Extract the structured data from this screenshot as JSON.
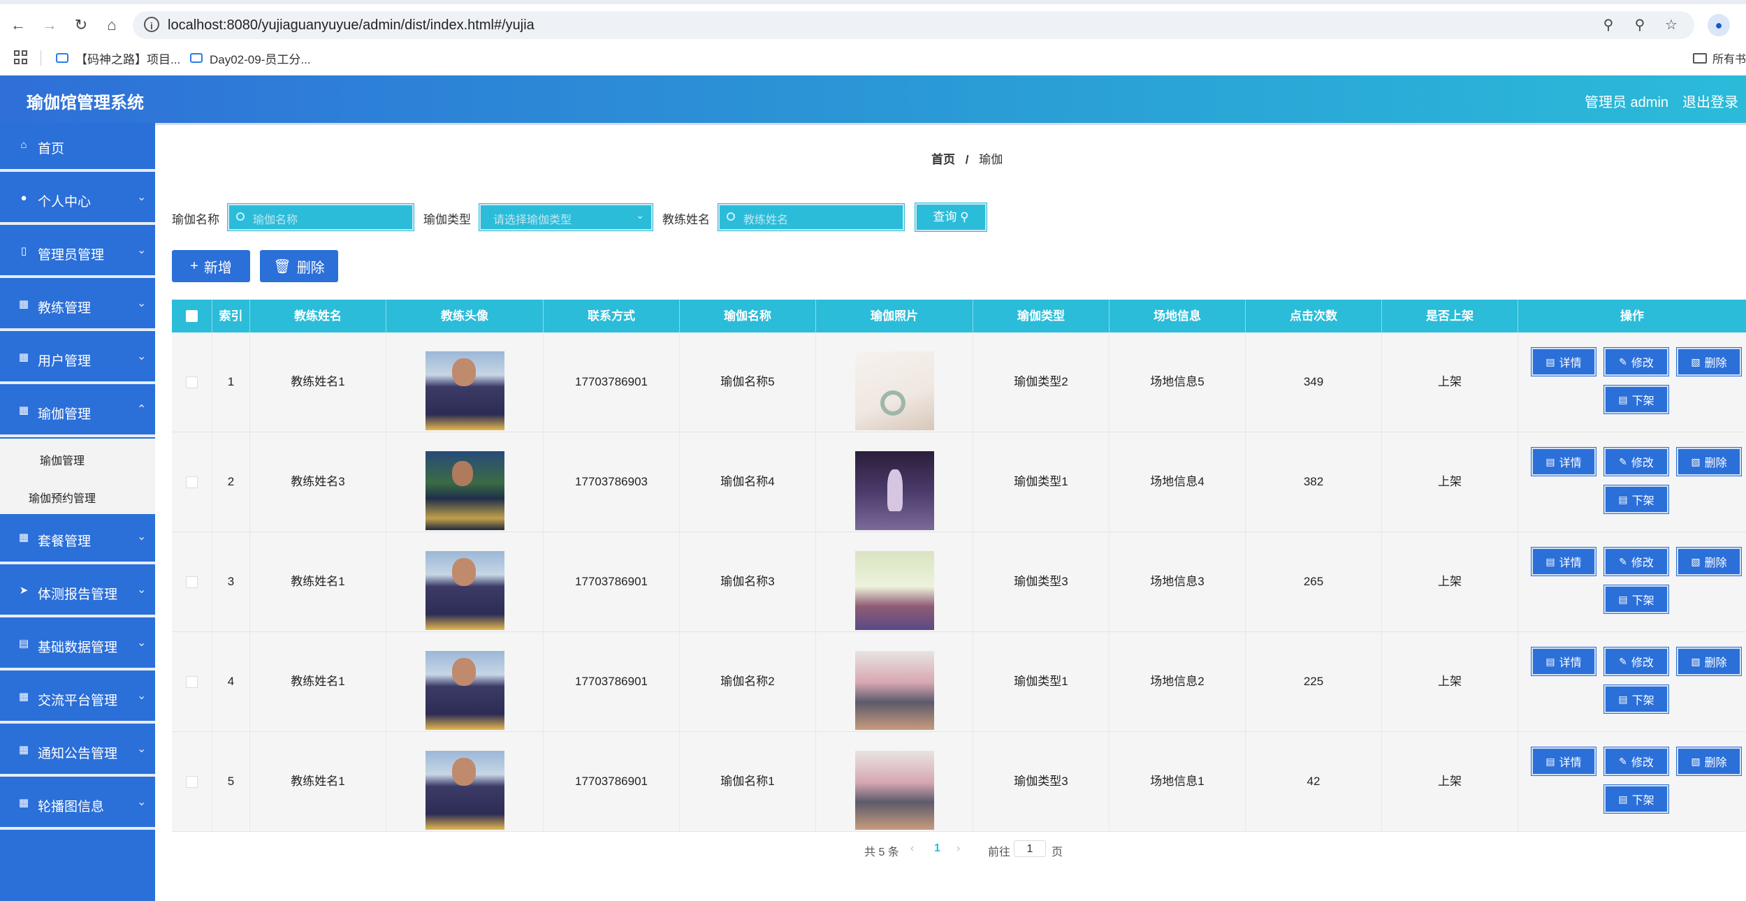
{
  "browser": {
    "url": "localhost:8080/yujiaguanyuyue/admin/dist/index.html#/yujia",
    "bookmarks": [
      "【码神之路】项目...",
      "Day02-09-员工分..."
    ],
    "bookmarks_right": "所有书"
  },
  "header": {
    "title": "瑜伽馆管理系统",
    "user": "管理员 admin",
    "logout": "退出登录"
  },
  "sidebar": {
    "items": [
      {
        "label": "首页",
        "icon": "home-icon"
      },
      {
        "label": "个人中心",
        "icon": "user-icon"
      },
      {
        "label": "管理员管理",
        "icon": "chart-icon"
      },
      {
        "label": "教练管理",
        "icon": "grid-icon"
      },
      {
        "label": "用户管理",
        "icon": "grid-icon"
      },
      {
        "label": "瑜伽管理",
        "icon": "grid-icon"
      }
    ],
    "sub_items": [
      "瑜伽管理",
      "瑜伽预约管理"
    ],
    "items_after": [
      {
        "label": "套餐管理",
        "icon": "grid-icon"
      },
      {
        "label": "体测报告管理",
        "icon": "send-icon"
      },
      {
        "label": "基础数据管理",
        "icon": "chat-icon"
      },
      {
        "label": "交流平台管理",
        "icon": "grid-icon"
      },
      {
        "label": "通知公告管理",
        "icon": "grid-icon"
      },
      {
        "label": "轮播图信息",
        "icon": "grid-icon"
      }
    ]
  },
  "breadcrumb": {
    "home": "首页",
    "sep": "/",
    "current": "瑜伽"
  },
  "search": {
    "name_label": "瑜伽名称",
    "name_placeholder": "瑜伽名称",
    "type_label": "瑜伽类型",
    "type_placeholder": "请选择瑜伽类型",
    "coach_label": "教练姓名",
    "coach_placeholder": "教练姓名",
    "query_label": "查询"
  },
  "actions": {
    "add_label": "新增",
    "delete_label": "删除"
  },
  "table": {
    "columns": [
      "索引",
      "教练姓名",
      "教练头像",
      "联系方式",
      "瑜伽名称",
      "瑜伽照片",
      "瑜伽类型",
      "场地信息",
      "点击次数",
      "是否上架",
      "操作"
    ],
    "rows": [
      {
        "index": "1",
        "coach": "教练姓名1",
        "phone": "17703786901",
        "yoga_name": "瑜伽名称5",
        "yoga_type": "瑜伽类型2",
        "venue": "场地信息5",
        "clicks": "349",
        "status": "上架"
      },
      {
        "index": "2",
        "coach": "教练姓名3",
        "phone": "17703786903",
        "yoga_name": "瑜伽名称4",
        "yoga_type": "瑜伽类型1",
        "venue": "场地信息4",
        "clicks": "382",
        "status": "上架"
      },
      {
        "index": "3",
        "coach": "教练姓名1",
        "phone": "17703786901",
        "yoga_name": "瑜伽名称3",
        "yoga_type": "瑜伽类型3",
        "venue": "场地信息3",
        "clicks": "265",
        "status": "上架"
      },
      {
        "index": "4",
        "coach": "教练姓名1",
        "phone": "17703786901",
        "yoga_name": "瑜伽名称2",
        "yoga_type": "瑜伽类型1",
        "venue": "场地信息2",
        "clicks": "225",
        "status": "上架"
      },
      {
        "index": "5",
        "coach": "教练姓名1",
        "phone": "17703786901",
        "yoga_name": "瑜伽名称1",
        "yoga_type": "瑜伽类型3",
        "venue": "场地信息1",
        "clicks": "42",
        "status": "上架"
      }
    ],
    "row_buttons": {
      "detail": "详情",
      "edit": "修改",
      "delete": "删除",
      "unlist": "下架"
    }
  },
  "pagination": {
    "total": "共 5 条",
    "current": "1",
    "goto": "前往",
    "page_input": "1",
    "page_unit": "页"
  },
  "colors": {
    "primary": "#2b6fd9",
    "accent": "#2bbcd9",
    "header_end": "#2bbcd9"
  }
}
